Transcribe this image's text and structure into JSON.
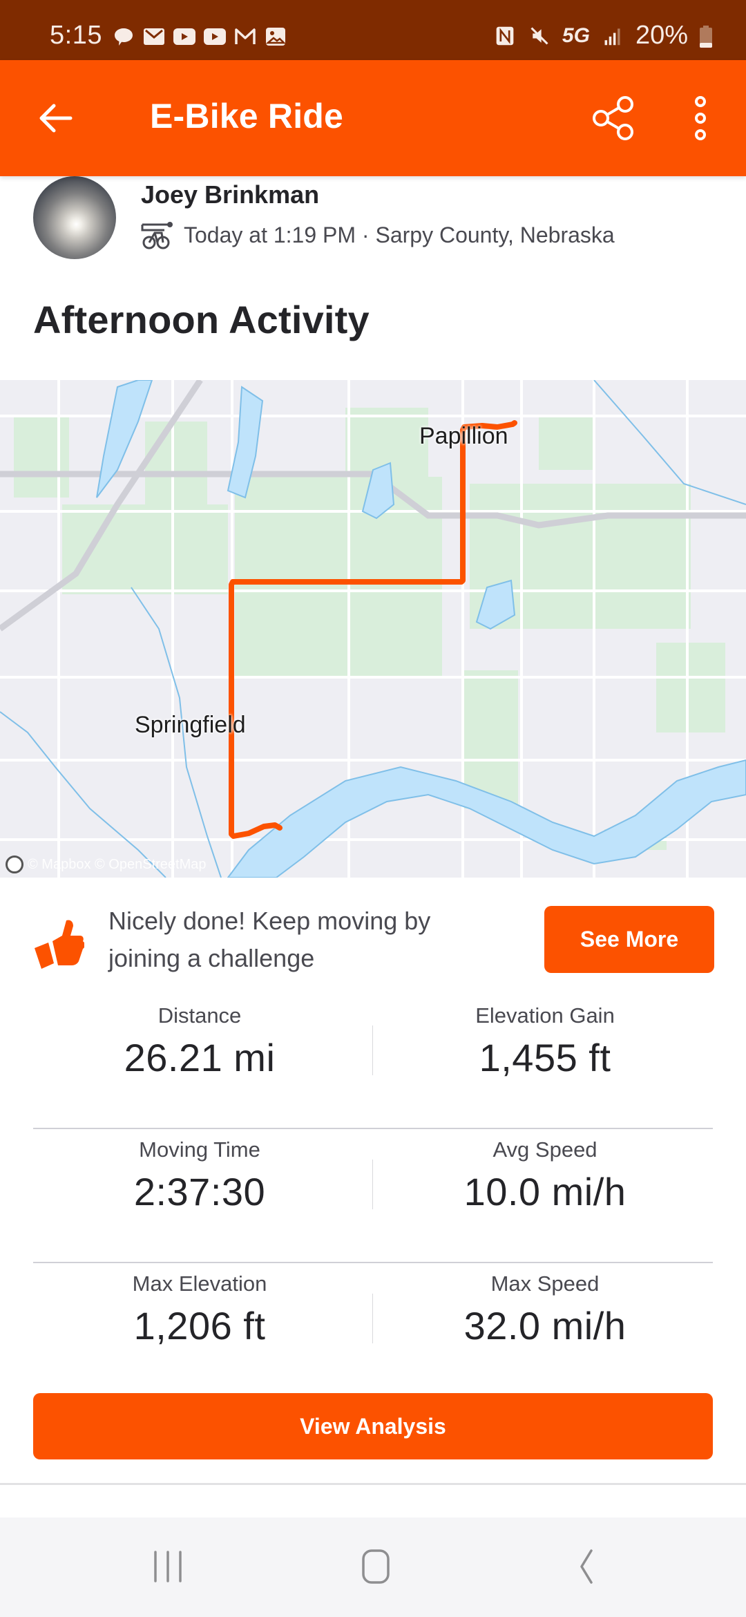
{
  "status_bar": {
    "time": "5:15",
    "notification_icons": [
      "messages-icon",
      "gmail-icon",
      "youtube-icon",
      "youtube-icon",
      "gmail-outline-icon",
      "gallery-icon"
    ],
    "system_icons": [
      "nfc-icon",
      "mute-icon",
      "5g-icon",
      "signal-icon"
    ],
    "network": "5G",
    "battery": "20%",
    "battery_level_pct": 20
  },
  "app_bar": {
    "title": "E-Bike Ride",
    "back_icon": "arrow-back-icon",
    "share_icon": "share-icon",
    "more_icon": "more-vertical-icon"
  },
  "athlete": {
    "name": "Joey Brinkman",
    "sport_icon": "ebike-icon",
    "meta": "Today at 1:19 PM · Sarpy County, Nebraska"
  },
  "activity": {
    "title": "Afternoon Activity"
  },
  "map": {
    "labels": [
      "Papillion",
      "Springfield"
    ],
    "attribution": "© Mapbox © OpenStreetMap",
    "route_color": "#fc5200"
  },
  "challenge": {
    "icon": "thumbs-up-icon",
    "text": "Nicely done! Keep moving by joining a challenge",
    "button_label": "See More"
  },
  "stats": [
    [
      {
        "label": "Distance",
        "value": "26.21 mi"
      },
      {
        "label": "Elevation Gain",
        "value": "1,455 ft"
      }
    ],
    [
      {
        "label": "Moving Time",
        "value": "2:37:30"
      },
      {
        "label": "Avg Speed",
        "value": "10.0 mi/h"
      }
    ],
    [
      {
        "label": "Max Elevation",
        "value": "1,206 ft"
      },
      {
        "label": "Max Speed",
        "value": "32.0 mi/h"
      }
    ]
  ],
  "actions": {
    "view_analysis_label": "View Analysis"
  },
  "nav_bar": {
    "recents_icon": "recents-icon",
    "home_icon": "home-icon",
    "back_icon": "nav-back-icon"
  },
  "colors": {
    "brand": "#fc5200",
    "status_bar": "#7f2b00",
    "text_primary": "#242428",
    "text_secondary": "#494950"
  }
}
